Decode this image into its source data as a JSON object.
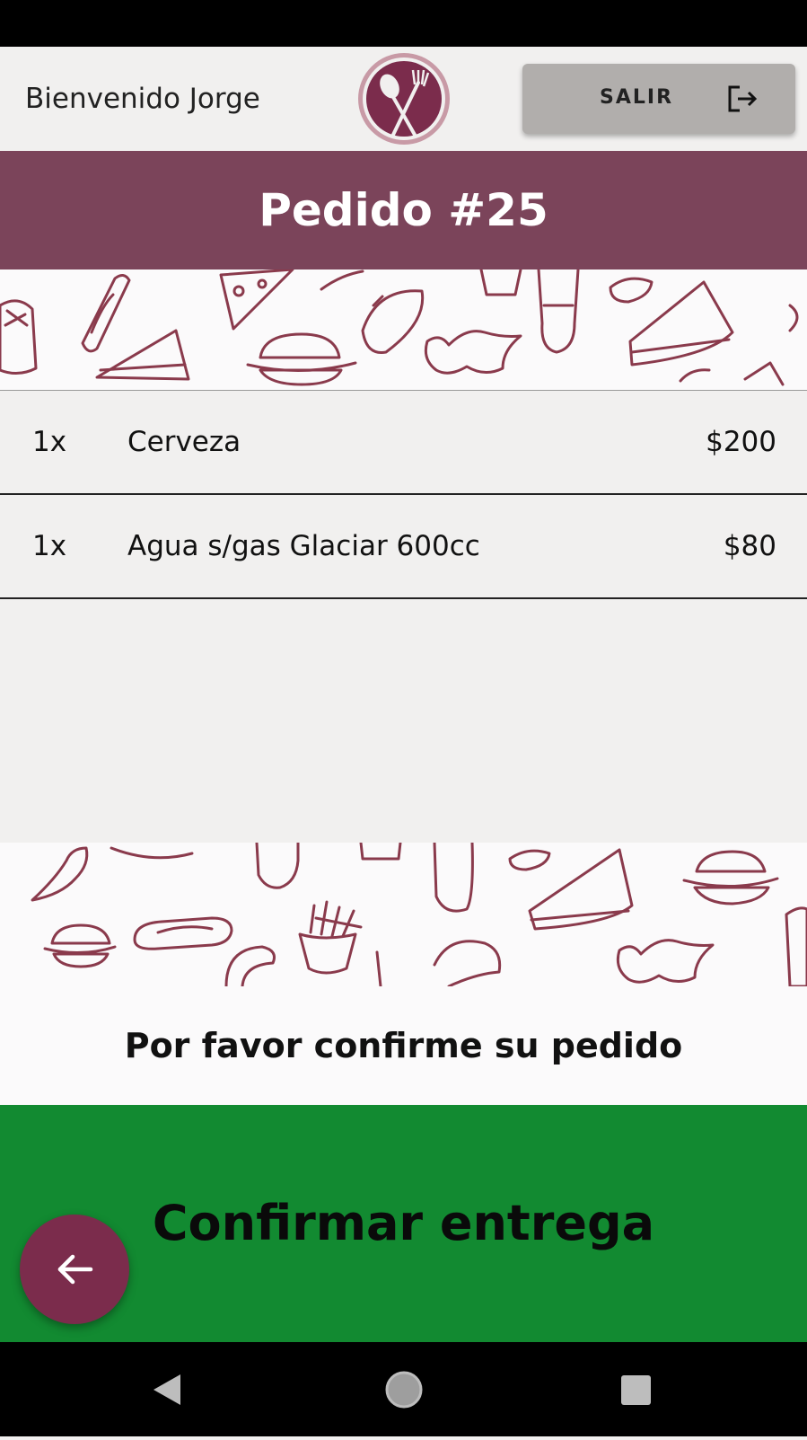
{
  "header": {
    "welcome_text": "Bienvenido Jorge",
    "logo_icon": "spoon-fork-logo-icon",
    "logout_label": "SALIR",
    "logout_icon": "logout-icon"
  },
  "order": {
    "title": "Pedido #25",
    "items": [
      {
        "qty": "1x",
        "name": "Cerveza",
        "price": "$200"
      },
      {
        "qty": "1x",
        "name": "Agua s/gas Glaciar 600cc",
        "price": "$80"
      }
    ]
  },
  "confirm_message": "Por favor confirme su pedido",
  "confirm_button_label": "Confirmar entrega",
  "fab_icon": "arrow-left-icon",
  "nav": {
    "back_icon": "nav-back-icon",
    "home_icon": "nav-home-icon",
    "recent_icon": "nav-recent-icon"
  },
  "colors": {
    "brand": "#7b445a",
    "fab": "#7b2c4c",
    "confirm": "#128a31",
    "logout_button": "#b1aeac"
  }
}
